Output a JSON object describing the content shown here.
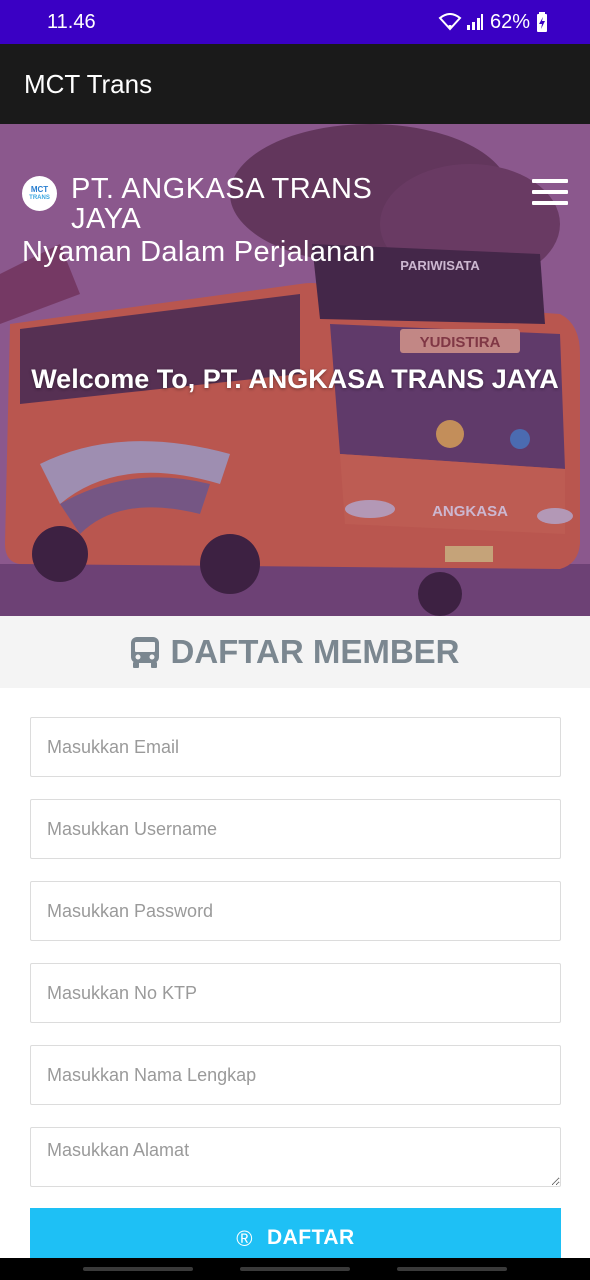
{
  "status_bar": {
    "time": "11.46",
    "battery": "62%",
    "icons": [
      "wifi-icon",
      "signal-icon",
      "battery-charging-icon"
    ]
  },
  "app_bar": {
    "title": "MCT Trans"
  },
  "hero": {
    "logo_line1": "MCT",
    "logo_line2": "TRANS",
    "company_name": "PT. ANGKASA TRANS JAYA",
    "tagline": "Nyaman Dalam Perjalanan",
    "welcome": "Welcome To, PT. ANGKASA TRANS JAYA",
    "bus_sign": "YUDISTIRA",
    "bus_brand": "ANGKASA",
    "bus_windshield": "PARIWISATA",
    "menu_icon": "hamburger-menu-icon"
  },
  "section": {
    "title": "DAFTAR MEMBER",
    "icon": "bus-icon"
  },
  "form": {
    "email_placeholder": "Masukkan Email",
    "username_placeholder": "Masukkan Username",
    "password_placeholder": "Masukkan Password",
    "ktp_placeholder": "Masukkan No KTP",
    "fullname_placeholder": "Masukkan Nama Lengkap",
    "address_placeholder": "Masukkan Alamat",
    "submit_label": "DAFTAR",
    "submit_icon_glyph": "®"
  },
  "colors": {
    "status_bar": "#3a00c4",
    "app_bar": "#1a1a1a",
    "section_text": "#7b8790",
    "submit": "#1ec0f5"
  }
}
